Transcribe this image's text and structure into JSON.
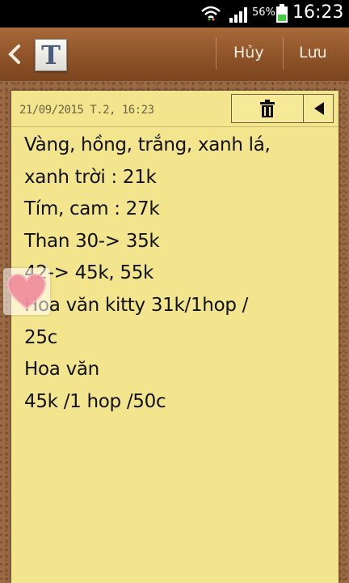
{
  "status_bar": {
    "battery_percent": "56%",
    "time": "16:23",
    "icons": [
      "wifi-icon",
      "signal-icon",
      "battery-icon"
    ]
  },
  "action_bar": {
    "back_icon": "chevron-left-icon",
    "app_icon_letter": "T",
    "cancel_label": "Hủy",
    "save_label": "Lưu"
  },
  "note": {
    "date": "21/09/2015 T.2, 16:23",
    "tools": [
      "trash-icon",
      "triangle-left-icon"
    ],
    "lines": [
      "Vàng, hồng, trắng, xanh lá,",
      "xanh trời : 21k",
      "Tím, cam : 27k",
      "Than 30-> 35k",
      "42-> 45k, 55k",
      "Hoa văn kitty 31k/1hop /",
      "25c",
      "Hoa văn",
      "45k /1 hop /50c"
    ]
  },
  "colors": {
    "paper": "#f3e58e",
    "wood": "#9b6a44",
    "action_bar": "#8e5328",
    "heart": "#f08a9a"
  }
}
